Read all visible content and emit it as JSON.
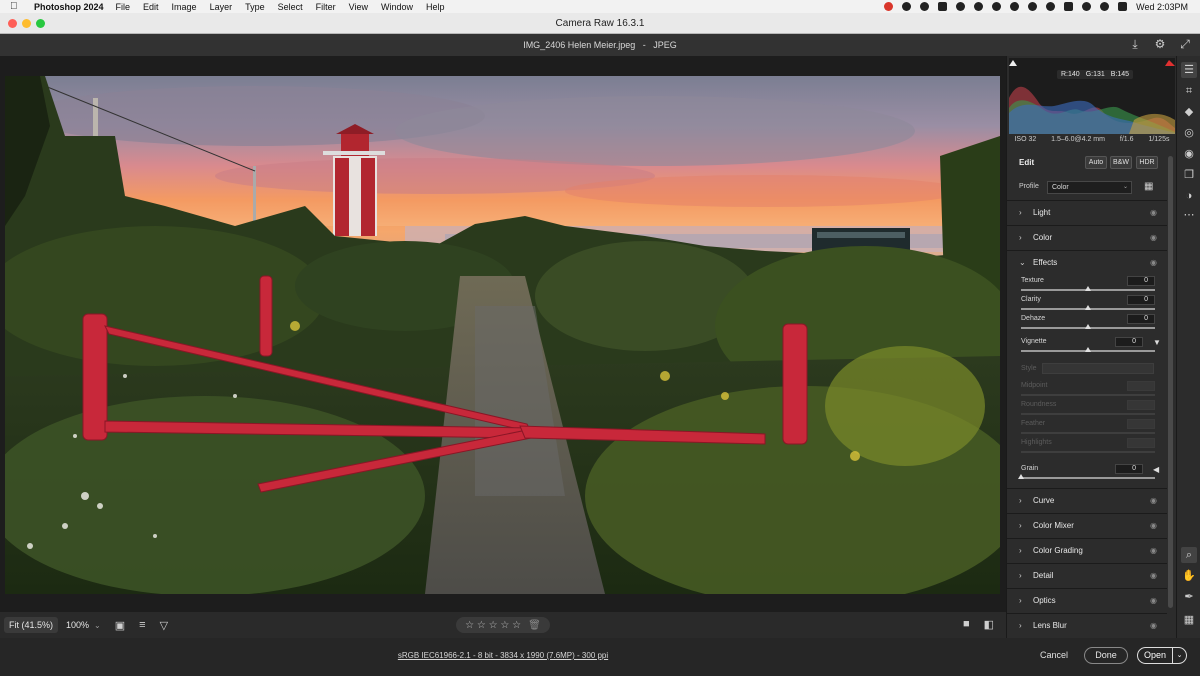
{
  "menubar": {
    "app_name": "Photoshop 2024",
    "items": [
      "File",
      "Edit",
      "Image",
      "Layer",
      "Type",
      "Select",
      "Filter",
      "View",
      "Window",
      "Help"
    ],
    "clock": "Wed 2:03PM"
  },
  "window": {
    "title": "Camera Raw 16.3.1"
  },
  "file": {
    "name": "IMG_2406 Helen Meier.jpeg",
    "separator": "-",
    "format": "JPEG"
  },
  "histogram": {
    "r_label": "R:",
    "r_value": "140",
    "g_label": "G:",
    "g_value": "131",
    "b_label": "B:",
    "b_value": "145"
  },
  "exif": {
    "iso": "ISO 32",
    "lens": "1.5–6.0@4.2 mm",
    "aperture": "f/1.6",
    "shutter": "1/125s"
  },
  "edit": {
    "title": "Edit",
    "auto": "Auto",
    "bw": "B&W",
    "hdr": "HDR",
    "profile_label": "Profile",
    "profile_value": "Color"
  },
  "sections": {
    "light": "Light",
    "color": "Color",
    "effects": "Effects",
    "curve": "Curve",
    "color_mixer": "Color Mixer",
    "color_grading": "Color Grading",
    "detail": "Detail",
    "optics": "Optics",
    "lens_blur": "Lens Blur"
  },
  "effects": {
    "texture": {
      "label": "Texture",
      "value": "0"
    },
    "clarity": {
      "label": "Clarity",
      "value": "0"
    },
    "dehaze": {
      "label": "Dehaze",
      "value": "0"
    },
    "vignette": {
      "label": "Vignette",
      "value": "0"
    },
    "style_label": "Style",
    "midpoint": "Midpoint",
    "roundness": "Roundness",
    "feather": "Feather",
    "highlights": "Highlights",
    "grain": {
      "label": "Grain",
      "value": "0"
    }
  },
  "canvas_toolbar": {
    "fit": "Fit (41.5%)",
    "zoom": "100%",
    "rating_stars": "☆ ☆ ☆ ☆ ☆"
  },
  "footer": {
    "info": "sRGB IEC61966-2.1 - 8 bit - 3834 x 1990 (7.6MP) - 300 ppi",
    "cancel": "Cancel",
    "done": "Done",
    "open": "Open"
  },
  "icons": {
    "apple": "apple-icon",
    "save": "save-download-icon",
    "settings": "gear-icon",
    "fullscreen": "expand-icon"
  },
  "colors": {
    "gate_red": "#c8283a",
    "sky_orange": "#f59a5a",
    "panel_bg": "#2c2c2c"
  }
}
